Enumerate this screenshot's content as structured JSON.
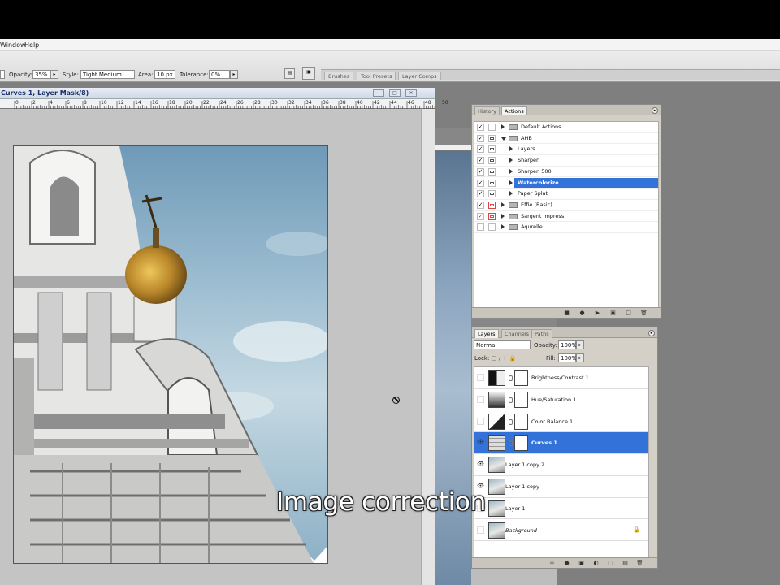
{
  "menu": {
    "window": "Window",
    "help": "Help"
  },
  "options": {
    "opacity_label": "Opacity:",
    "opacity_value": "35%",
    "style_label": "Style:",
    "style_value": "Tight Medium",
    "area_label": "Area:",
    "area_value": "10 px",
    "tolerance_label": "Tolerance:",
    "tolerance_value": "0%"
  },
  "well_tabs": [
    "Brushes",
    "Tool Presets",
    "Layer Comps"
  ],
  "document": {
    "title": "Curves 1, Layer Mask/8)",
    "ruler_labels": [
      "0",
      "2",
      "4",
      "6",
      "8",
      "10",
      "12",
      "14",
      "16",
      "18",
      "20",
      "22",
      "24",
      "26",
      "28",
      "30",
      "32",
      "34",
      "36",
      "38",
      "40",
      "42",
      "44",
      "46",
      "48",
      "50"
    ]
  },
  "actions_panel": {
    "tabs": [
      "History",
      "Actions"
    ],
    "rows": [
      {
        "label": "Default Actions",
        "checked": true,
        "dialog": false,
        "level": 0,
        "folder": true,
        "expanded": false
      },
      {
        "label": "AHB",
        "checked": true,
        "dialog": true,
        "level": 0,
        "folder": true,
        "expanded": true
      },
      {
        "label": "Layers",
        "checked": true,
        "dialog": true,
        "level": 1,
        "folder": false,
        "expanded": false
      },
      {
        "label": "Sharpen",
        "checked": true,
        "dialog": true,
        "level": 1,
        "folder": false,
        "expanded": false
      },
      {
        "label": "Sharpen 500",
        "checked": true,
        "dialog": true,
        "level": 1,
        "folder": false,
        "expanded": false
      },
      {
        "label": "Watercolorize",
        "checked": true,
        "dialog": true,
        "level": 1,
        "folder": false,
        "expanded": false,
        "selected": true
      },
      {
        "label": "Paper Splat",
        "checked": true,
        "dialog": true,
        "level": 1,
        "folder": false,
        "expanded": false
      },
      {
        "label": "Effie (Basic)",
        "checked": true,
        "dialog": true,
        "dialog_red": true,
        "level": 0,
        "folder": true,
        "expanded": false
      },
      {
        "label": "Sargent Impress",
        "checked": true,
        "check_red": true,
        "dialog": true,
        "dialog_red": true,
        "level": 0,
        "folder": true,
        "expanded": false
      },
      {
        "label": "Aqurelle",
        "checked": false,
        "dialog": false,
        "level": 0,
        "folder": true,
        "expanded": false
      }
    ],
    "footer_icons": [
      "stop-icon",
      "record-icon",
      "play-icon",
      "new-set-icon",
      "new-action-icon",
      "delete-icon"
    ]
  },
  "layers_panel": {
    "tabs": [
      "Layers",
      "Channels",
      "Paths"
    ],
    "blend_mode": "Normal",
    "opacity_label": "Opacity:",
    "opacity_value": "100%",
    "lock_label": "Lock:",
    "fill_label": "Fill:",
    "fill_value": "100%",
    "layers": [
      {
        "name": "Brightness/Contrast 1",
        "visible": false,
        "adjustment": true
      },
      {
        "name": "Hue/Saturation 1",
        "visible": false,
        "adjustment": true
      },
      {
        "name": "Color Balance 1",
        "visible": false,
        "adjustment": true
      },
      {
        "name": "Curves 1",
        "visible": true,
        "adjustment": true,
        "selected": true
      },
      {
        "name": "Layer 1 copy 2",
        "visible": true,
        "adjustment": false
      },
      {
        "name": "Layer 1 copy",
        "visible": true,
        "adjustment": false
      },
      {
        "name": "Layer 1",
        "visible": false,
        "adjustment": false
      },
      {
        "name": "Background",
        "visible": false,
        "adjustment": false,
        "italic": true,
        "locked": true
      }
    ]
  },
  "caption": "Image correction",
  "colors": {
    "selection": "#3372d8",
    "panel": "#d4d0c8",
    "sky": "#8fb2c8",
    "dome": "#c6962e"
  }
}
